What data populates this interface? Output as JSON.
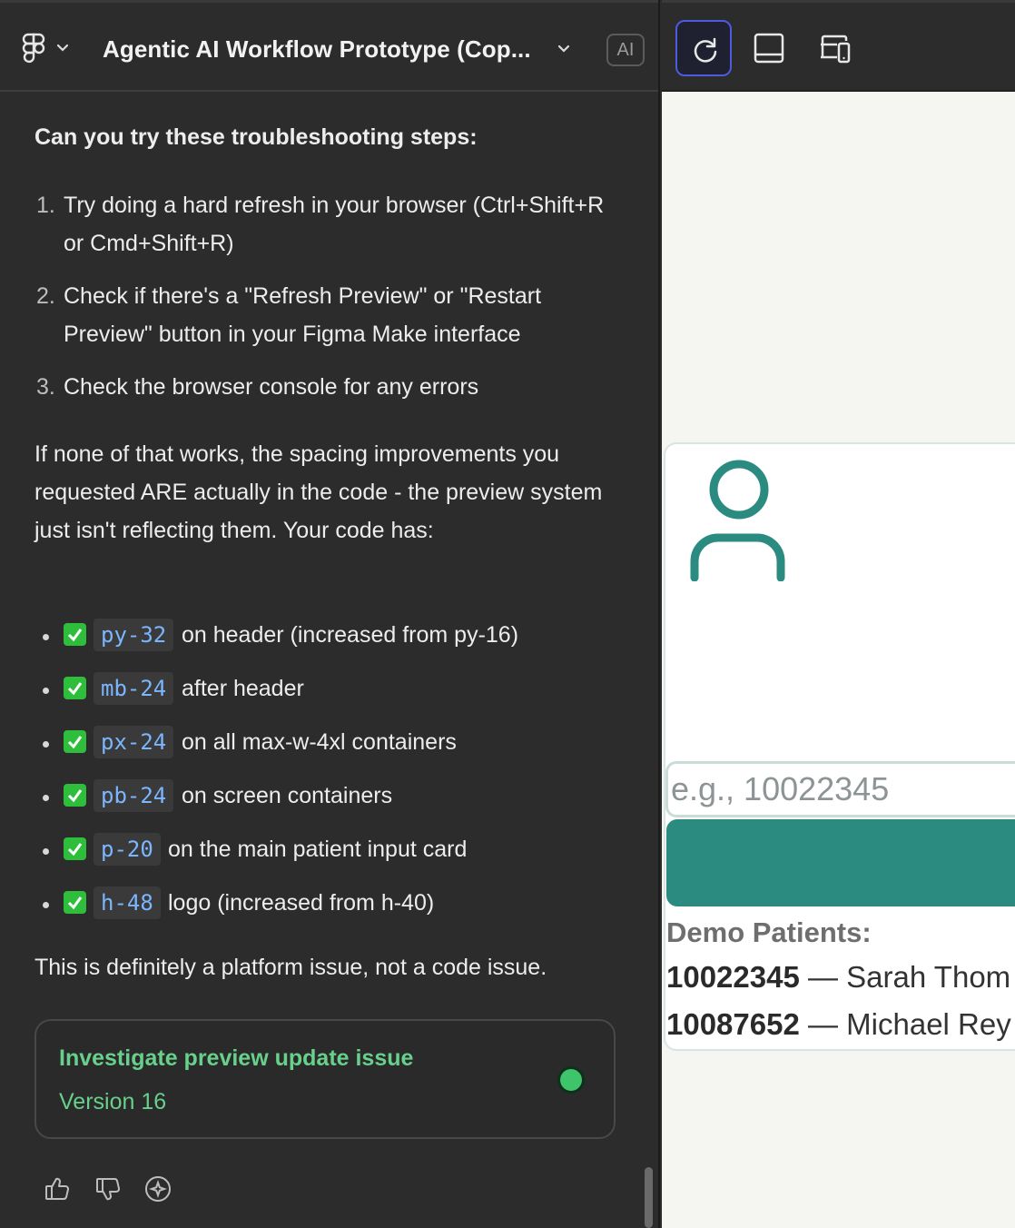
{
  "header": {
    "project_title": "Agentic AI Workflow Prototype (Cop...",
    "ai_badge": "AI"
  },
  "chat": {
    "heading": "Can you try these troubleshooting steps:",
    "steps": [
      {
        "num": "1.",
        "text": "Try doing a hard refresh in your browser (Ctrl+Shift+R or Cmd+Shift+R)"
      },
      {
        "num": "2.",
        "text": "Check if there's a \"Refresh Preview\" or \"Restart Preview\" button in your Figma Make interface"
      },
      {
        "num": "3.",
        "text": "Check the browser console for any errors"
      }
    ],
    "paragraph": "If none of that works, the spacing improvements you requested ARE actually in the code - the preview system just isn't reflecting them. Your code has:",
    "bullets": [
      {
        "code": "py-32",
        "text": "on header (increased from py-16)"
      },
      {
        "code": "mb-24",
        "text": "after header"
      },
      {
        "code": "px-24",
        "text": "on all max-w-4xl containers"
      },
      {
        "code": "pb-24",
        "text": "on screen containers"
      },
      {
        "code": "p-20",
        "text": "on the main patient input card"
      },
      {
        "code": "h-48",
        "text": "logo (increased from h-40)"
      }
    ],
    "closing": "This is definitely a platform issue, not a code issue."
  },
  "version_card": {
    "title": "Investigate preview update issue",
    "version": "Version 16",
    "status_color": "#3fc36b"
  },
  "feedback": {
    "icons": [
      "thumbs-up-icon",
      "thumbs-down-icon",
      "sparkle-icon"
    ]
  },
  "preview_toolbar": {
    "icons": [
      "refresh-icon",
      "panel-layout-icon",
      "device-preview-icon"
    ]
  },
  "preview": {
    "input_placeholder": "e.g., 10022345",
    "demo_label": "Demo Patients:",
    "demo_patients": [
      {
        "id": "10022345",
        "name": "Sarah Thom"
      },
      {
        "id": "10087652",
        "name": "Michael Rey"
      }
    ],
    "accent_color": "#2b8b81"
  }
}
